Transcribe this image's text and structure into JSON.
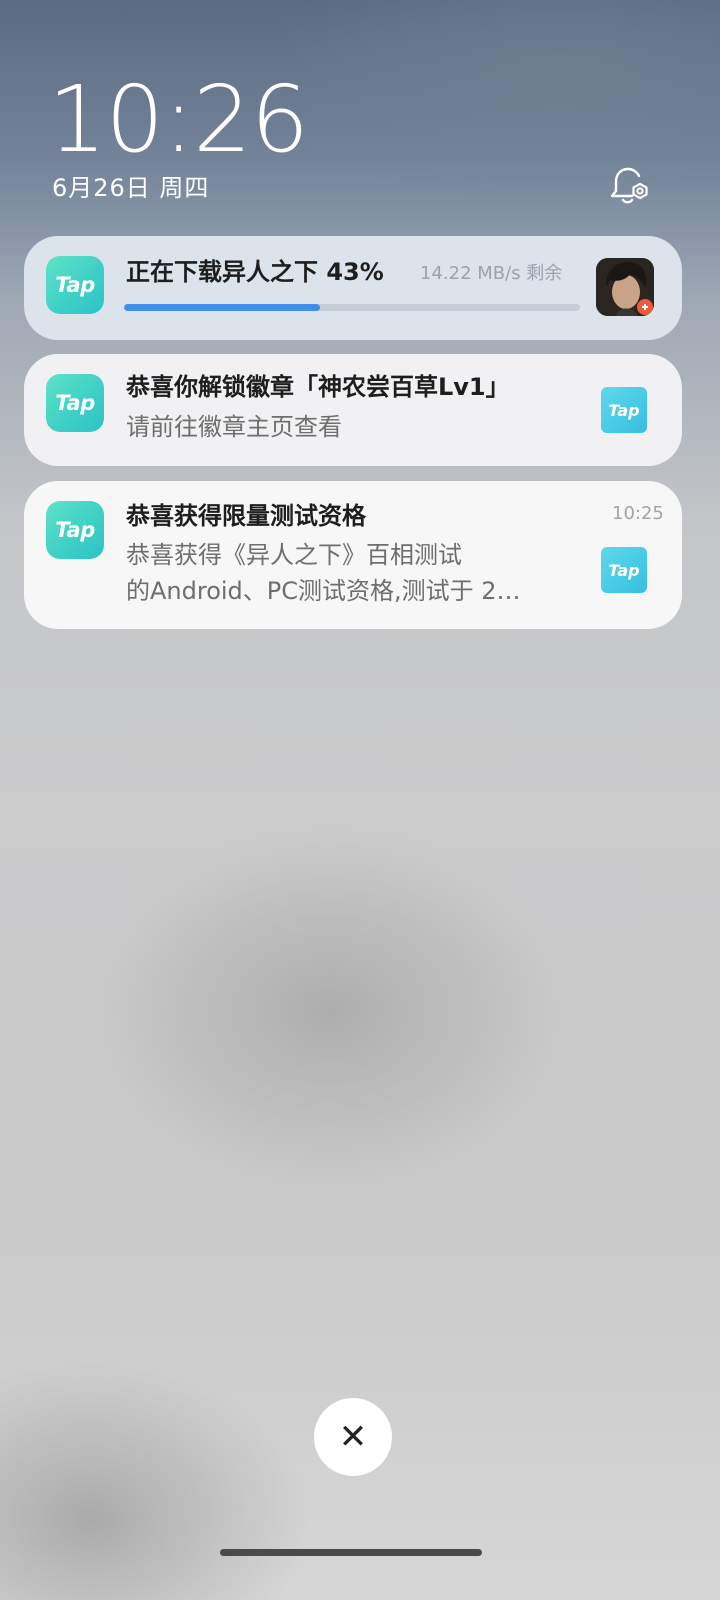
{
  "lockscreen": {
    "time": "10:26",
    "date": "6月26日 周四"
  },
  "notifications": [
    {
      "app_icon_text": "Tap",
      "title": "正在下载异人之下 43%",
      "speed": "14.22 MB/s  剩余",
      "progress": 0.43,
      "thumbnail": "game-character-thumbnail"
    },
    {
      "app_icon_text": "Tap",
      "title": "恭喜你解锁徽章「神农尝百草Lv1」",
      "body": "请前往徽章主页查看",
      "side_icon_text": "Tap"
    },
    {
      "app_icon_text": "Tap",
      "title": "恭喜获得限量测试资格",
      "body_line1": "恭喜获得《异人之下》百相测试",
      "body_line2": "的Android、PC测试资格,测试于 2…",
      "time": "10:25",
      "side_icon_text": "Tap"
    }
  ],
  "close_button": {
    "glyph": "✕"
  },
  "icons": {
    "settings": "notification-settings-icon",
    "close": "close-icon"
  },
  "colors": {
    "tap_brand": "#3fd0c6",
    "progress": "#3f8fe8"
  }
}
